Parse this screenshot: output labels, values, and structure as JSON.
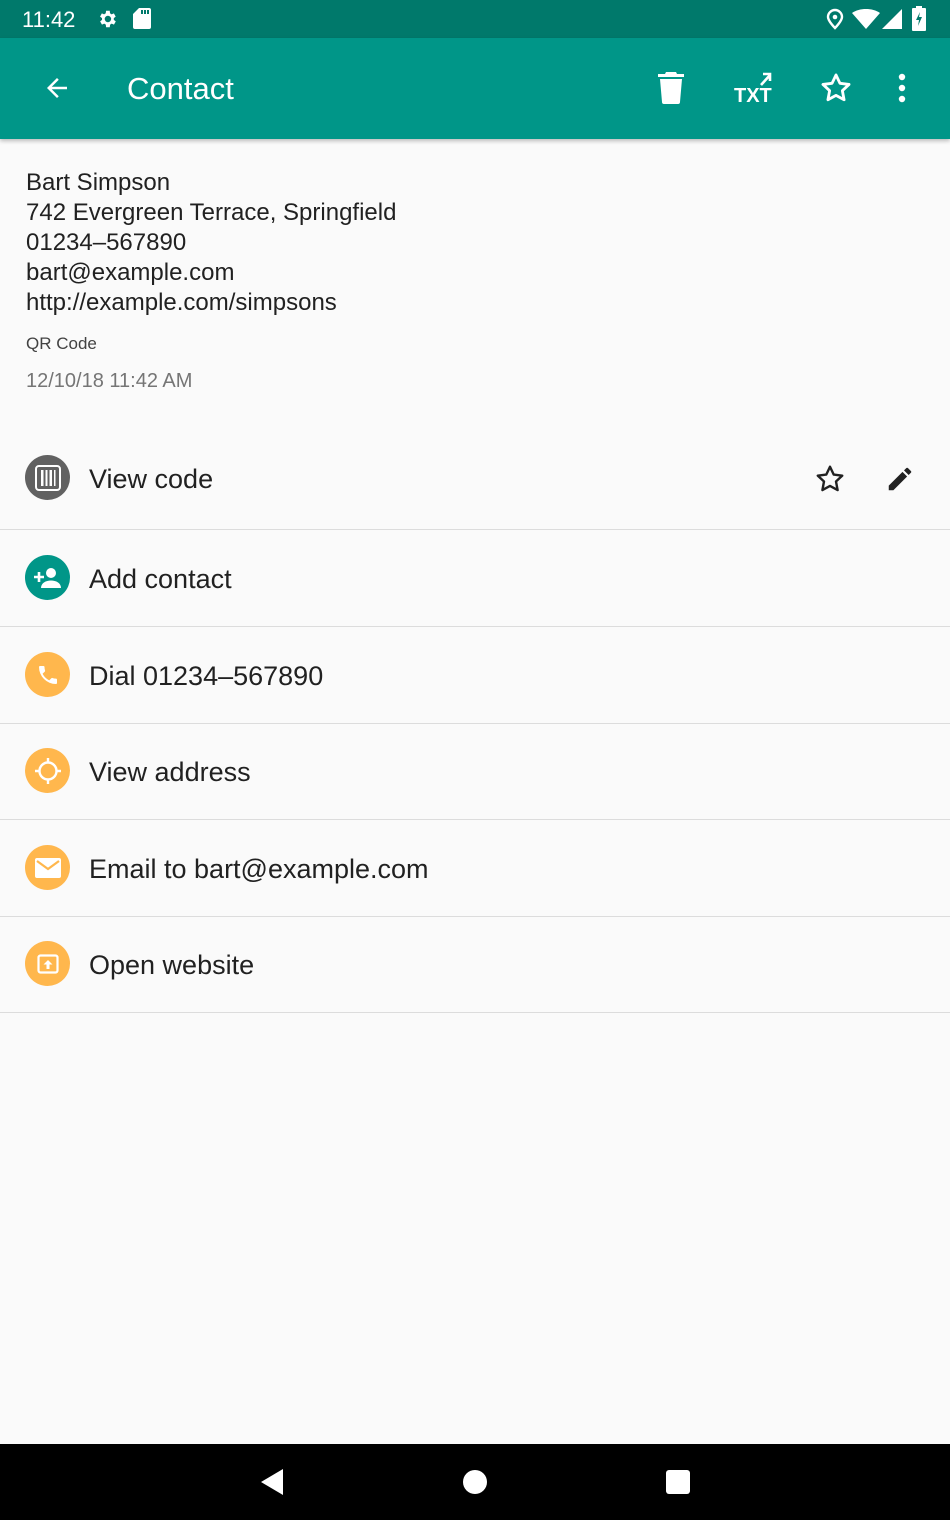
{
  "status_bar": {
    "time": "11:42",
    "icons": [
      "settings-icon",
      "sd-card-icon",
      "location-icon",
      "wifi-icon",
      "signal-icon",
      "battery-icon"
    ]
  },
  "app_bar": {
    "title": "Contact",
    "actions": [
      "back-arrow-icon",
      "delete-icon",
      "export-txt-icon",
      "star-outline-icon",
      "more-vert-icon"
    ]
  },
  "scan": {
    "contact_lines": [
      "Bart Simpson",
      "742 Evergreen Terrace, Springfield",
      "01234–567890",
      "bart@example.com",
      "http://example.com/simpsons"
    ],
    "format": "QR Code",
    "date": "12/10/18 11:42 AM"
  },
  "actions": [
    {
      "label": "View code",
      "icon": "barcode-icon",
      "color": "#616161"
    },
    {
      "label": "Add contact",
      "icon": "person-add-icon",
      "color": "#009688"
    },
    {
      "label": "Dial 01234–567890",
      "icon": "phone-icon",
      "color": "#ffb74d"
    },
    {
      "label": "View address",
      "icon": "gps-target-icon",
      "color": "#ffb74d"
    },
    {
      "label": "Email to bart@example.com",
      "icon": "email-icon",
      "color": "#ffb74d"
    },
    {
      "label": "Open website",
      "icon": "open-in-browser-icon",
      "color": "#ffb74d"
    }
  ],
  "colors": {
    "primary": "#009688",
    "primary_dark": "#00796b",
    "accent_orange": "#ffb74d"
  }
}
